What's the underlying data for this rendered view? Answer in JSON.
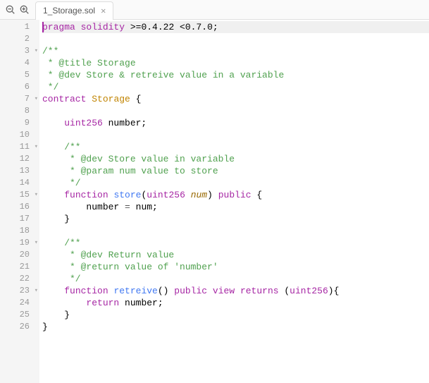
{
  "toolbar": {
    "zoom_out_title": "Zoom Out",
    "zoom_in_title": "Zoom In"
  },
  "tab": {
    "filename": "1_Storage.sol",
    "close_title": "Close"
  },
  "gutter": {
    "lines": [
      "1",
      "2",
      "3",
      "4",
      "5",
      "6",
      "7",
      "8",
      "9",
      "10",
      "11",
      "12",
      "13",
      "14",
      "15",
      "16",
      "17",
      "18",
      "19",
      "20",
      "21",
      "22",
      "23",
      "24",
      "25",
      "26"
    ],
    "fold_lines": [
      3,
      7,
      11,
      15,
      19,
      23
    ]
  },
  "code": {
    "l1_kw1": "pragma",
    "l1_kw2": "solidity",
    "l1_ver": " >=0.4.22 <0.7.0;",
    "l3": "/**",
    "l4": " * @title Storage",
    "l5": " * @dev Store & retreive value in a variable",
    "l6": " */",
    "l7_kw": "contract",
    "l7_name": "Storage",
    "l7_brace": " {",
    "l9_kw": "uint256",
    "l9_rest": " number;",
    "l11": "    /**",
    "l12": "     * @dev Store value in variable",
    "l13": "     * @param num value to store",
    "l14": "     */",
    "l15_kw": "function",
    "l15_fn": "store",
    "l15_p1": "(",
    "l15_type": "uint256",
    "l15_param": "num",
    "l15_p2": ")",
    "l15_vis": "public",
    "l15_brace": " {",
    "l16_a": "        number ",
    "l16_op": "=",
    "l16_b": " num;",
    "l17": "    }",
    "l19": "    /**",
    "l20": "     * @dev Return value ",
    "l21": "     * @return value of 'number'",
    "l22": "     */",
    "l23_kw": "function",
    "l23_fn": "retreive",
    "l23_p1": "()",
    "l23_vis": "public",
    "l23_view": "view",
    "l23_ret": "returns",
    "l23_p2": " (",
    "l23_type": "uint256",
    "l23_p3": "){",
    "l24_pre": "        ",
    "l24_kw": "return",
    "l24_rest": " number;",
    "l25": "    }",
    "l26": "}"
  }
}
